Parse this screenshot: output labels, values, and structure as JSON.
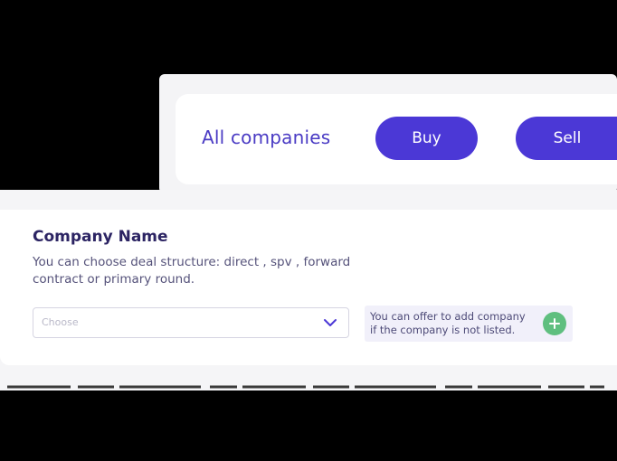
{
  "filter_bar": {
    "title": "All companies",
    "buy_label": "Buy",
    "sell_label": "Sell"
  },
  "company_form": {
    "title": "Company Name",
    "description": "You can choose deal structure: direct , spv , forward contract or primary round.",
    "select": {
      "placeholder": "Choose",
      "icon": "chevron-down-icon"
    },
    "hint": {
      "line1": "You can offer to add company",
      "line2": "if the company is not listed.",
      "icon": "plus-icon"
    }
  },
  "colors": {
    "accent": "#4b38d6",
    "title": "#2c2463",
    "add": "#5fbf7f"
  }
}
